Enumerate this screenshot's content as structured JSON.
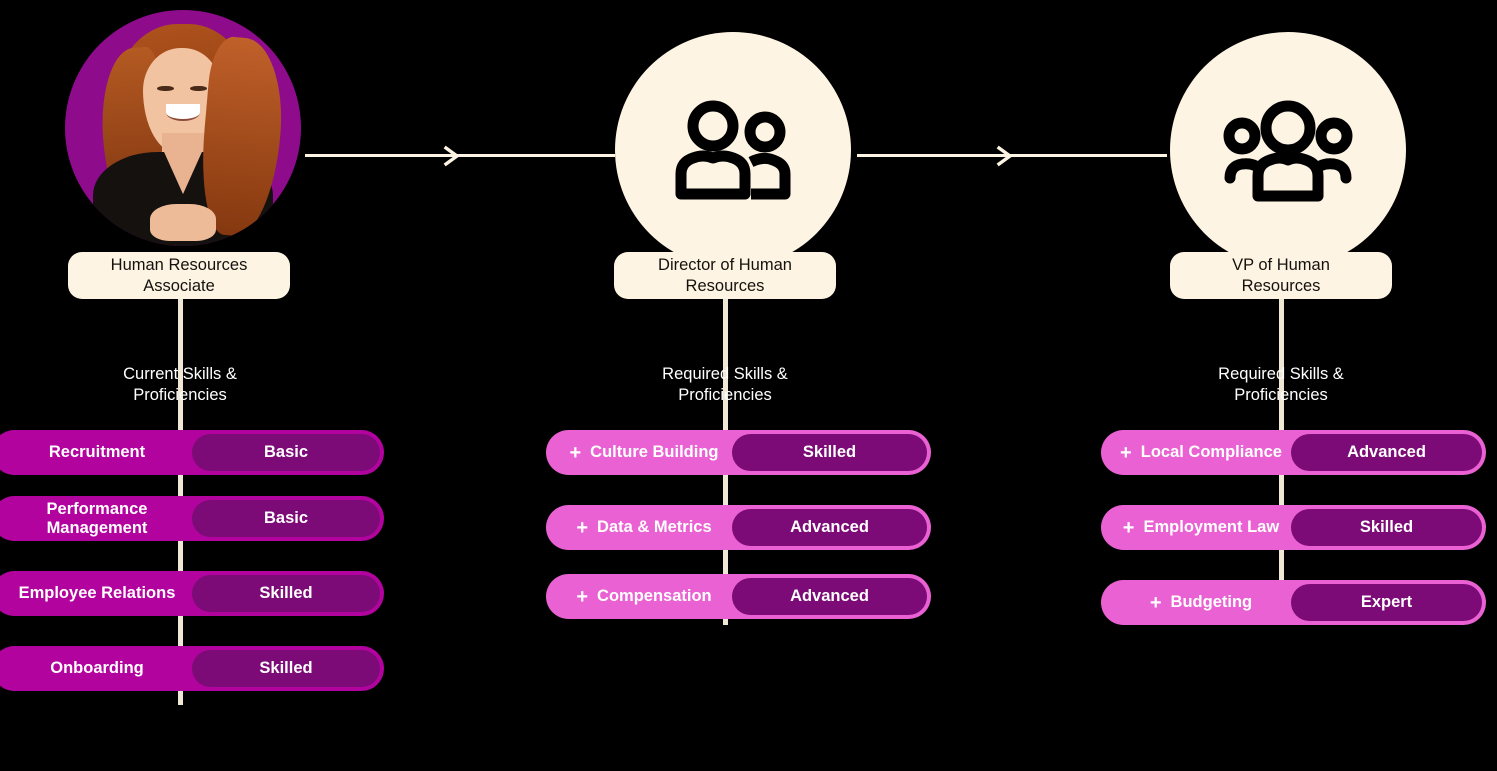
{
  "theme": {
    "background": "#000000",
    "cream": "#FDF4E3",
    "stem": "#EFE8D5",
    "current_pill": "#B3039E",
    "required_pill": "#E961D2",
    "level_pill": "#7C0B77",
    "photo_circle": "#8E0B8B",
    "text_light": "#FFFFFF",
    "text_dark": "#15120E"
  },
  "columns": [
    {
      "id": "current",
      "node": {
        "kind": "photo",
        "avatar_name": "employee-photo",
        "title": "Human Resources\nAssociate",
        "title_line1": "Human Resources",
        "title_line2": "Associate"
      },
      "caption": "Current Skills &\nProficiencies",
      "caption_line1": "Current Skills &",
      "caption_line2": "Proficiencies",
      "show_plus": false,
      "skills": [
        {
          "name": "Recruitment",
          "level": "Basic"
        },
        {
          "name": "Performance\nManagement",
          "name_line1": "Performance",
          "name_line2": "Management",
          "level": "Basic"
        },
        {
          "name": "Employee Relations",
          "level": "Skilled"
        },
        {
          "name": "Onboarding",
          "level": "Skilled"
        }
      ]
    },
    {
      "id": "director",
      "node": {
        "kind": "icon",
        "icon": "two-people-icon",
        "title": "Director of Human\nResources",
        "title_line1": "Director of Human",
        "title_line2": "Resources"
      },
      "caption": "Required Skills &\nProficiencies",
      "caption_line1": "Required Skills &",
      "caption_line2": "Proficiencies",
      "show_plus": true,
      "plus_glyph": "+",
      "skills": [
        {
          "name": "Culture Building",
          "level": "Skilled"
        },
        {
          "name": "Data & Metrics",
          "level": "Advanced"
        },
        {
          "name": "Compensation",
          "level": "Advanced"
        }
      ]
    },
    {
      "id": "vp",
      "node": {
        "kind": "icon",
        "icon": "three-people-group-icon",
        "title": "VP of Human\nResources",
        "title_line1": "VP of Human",
        "title_line2": "Resources"
      },
      "caption": "Required Skills &\nProficiencies",
      "caption_line1": "Required Skills &",
      "caption_line2": "Proficiencies",
      "show_plus": true,
      "plus_glyph": "+",
      "skills": [
        {
          "name": "Local Compliance",
          "level": "Advanced"
        },
        {
          "name": "Employment Law",
          "level": "Skilled"
        },
        {
          "name": "Budgeting",
          "level": "Expert"
        }
      ]
    }
  ],
  "connectors": [
    {
      "id": "arrow-1",
      "from": "current",
      "to": "director",
      "icon": "chevron-right-icon"
    },
    {
      "id": "arrow-2",
      "from": "director",
      "to": "vp",
      "icon": "chevron-right-icon"
    }
  ]
}
